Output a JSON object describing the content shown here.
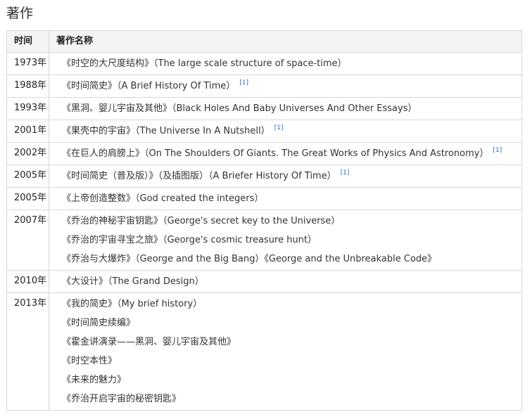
{
  "section": {
    "title": "著作"
  },
  "table": {
    "headers": {
      "year": "时间",
      "title": "著作名称"
    },
    "rows": [
      {
        "year": "1973年",
        "works": [
          {
            "text": "《时空的大尺度结构》（The large scale structure of space-time）",
            "ref": ""
          }
        ]
      },
      {
        "year": "1988年",
        "works": [
          {
            "text": "《时间简史》（A Brief History Of Time）",
            "ref": "[1]"
          }
        ]
      },
      {
        "year": "1993年",
        "works": [
          {
            "text": "《黑洞、婴儿宇宙及其他》（Black Holes And Baby Universes And Other Essays）",
            "ref": ""
          }
        ]
      },
      {
        "year": "2001年",
        "works": [
          {
            "text": "《果壳中的宇宙》（The Universe In A Nutshell）",
            "ref": "[1]"
          }
        ]
      },
      {
        "year": "2002年",
        "works": [
          {
            "text": "《在巨人的肩膀上》（On The Shoulders Of Giants. The Great Works of Physics And Astronomy）",
            "ref": "[1]"
          }
        ]
      },
      {
        "year": "2005年",
        "works": [
          {
            "text": "《时间简史（普及版）》（及插图版）（A Briefer History Of Time）",
            "ref": "[1]"
          }
        ]
      },
      {
        "year": "2005年",
        "works": [
          {
            "text": "《上帝创造整数》（God created the integers）",
            "ref": ""
          }
        ]
      },
      {
        "year": "2007年",
        "works": [
          {
            "text": "《乔治的神秘宇宙钥匙》（George's secret key to the Universe）",
            "ref": ""
          },
          {
            "text": "《乔治的宇宙寻宝之旅》（George's cosmic treasure hunt）",
            "ref": ""
          },
          {
            "text": "《乔治与大爆炸》（George and the Big Bang）《George and the Unbreakable Code》",
            "ref": ""
          }
        ]
      },
      {
        "year": "2010年",
        "works": [
          {
            "text": "《大设计》（The Grand Design）",
            "ref": ""
          }
        ]
      },
      {
        "year": "2013年",
        "works": [
          {
            "text": "《我的简史》（My brief history）",
            "ref": ""
          },
          {
            "text": "《时间简史续编》",
            "ref": ""
          },
          {
            "text": "《霍金讲演录——黑洞、婴儿宇宙及其他》",
            "ref": ""
          },
          {
            "text": "《时空本性》",
            "ref": ""
          },
          {
            "text": "《未来的魅力》",
            "ref": ""
          },
          {
            "text": "《乔治开启宇宙的秘密钥匙》",
            "ref": ""
          }
        ]
      }
    ]
  }
}
